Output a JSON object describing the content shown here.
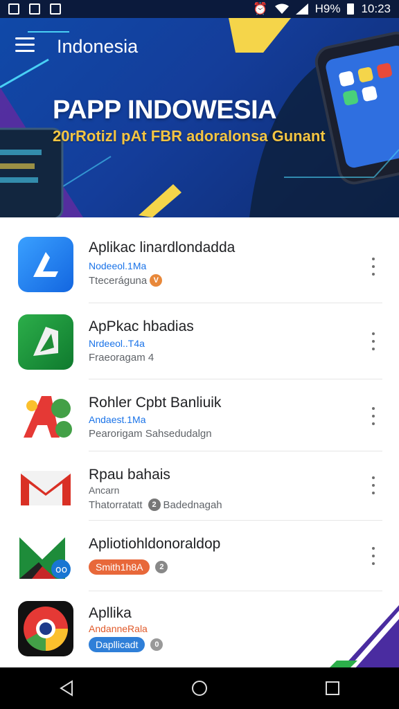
{
  "status_bar": {
    "battery": "H9%",
    "time": "10:23"
  },
  "header": {
    "title": "Indonesia"
  },
  "banner": {
    "title": "PAPP INDOWESIA",
    "subtitle": "20rRotizl pAt FBR adoralonsa Gunant"
  },
  "apps": [
    {
      "name": "Aplikac linardlondadda",
      "developer": "Nodeeol.1Ma",
      "meta": "Tteceráguna",
      "badge": "V",
      "badge_color": "#e8883a",
      "dev_color": "#1a73e8",
      "icon": "app-store-icon"
    },
    {
      "name": "ApPkac hbadias",
      "developer": "Nrdeeol..T4a",
      "meta": "Fraeoragam 4",
      "badge": "",
      "dev_color": "#1a73e8",
      "icon": "green-play-icon"
    },
    {
      "name": "Rohler Cpbt Banliuik",
      "developer": "Andaest.1Ma",
      "meta": "Pearorigam Sahsedudalgn",
      "badge": "",
      "dev_color": "#1a73e8",
      "icon": "a-logo-icon"
    },
    {
      "name": "Rpau bahais",
      "developer": "Ancarn",
      "meta": "Thatorratatt",
      "badge": "2",
      "badge_color": "#777777",
      "meta_after": "Badednagah",
      "dev_color": "#5f6368",
      "icon": "gmail-icon"
    },
    {
      "name": "Apliotiohldonoraldop",
      "developer": "",
      "pill": "Smith1h8A",
      "pill_color": "#e8683a",
      "badge": "2",
      "badge_color": "#888888",
      "icon": "green-envelope-icon"
    },
    {
      "name": "Apllika",
      "developer": "AndanneRala",
      "pill": "Dapllicadt",
      "pill_color": "#2f7fd8",
      "badge": "0",
      "badge_color": "#999999",
      "dev_color": "#e05a2a",
      "icon": "chrome-icon"
    }
  ],
  "colors": {
    "accent_blue": "#1049a8",
    "banner_yellow": "#f4c542"
  }
}
